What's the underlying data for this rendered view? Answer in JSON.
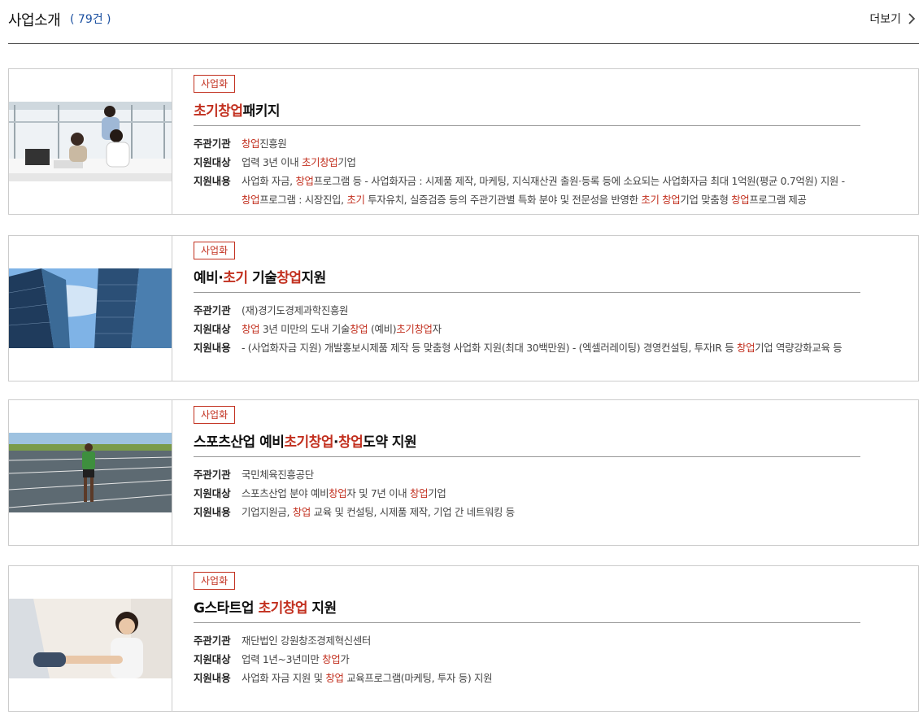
{
  "header": {
    "title": "사업소개",
    "count": "( 79건 )",
    "more_label": "더보기"
  },
  "labels": {
    "org": "주관기관",
    "target": "지원대상",
    "content": "지원내용"
  },
  "colors": {
    "highlight": "#c2301f",
    "count": "#1a4fa0"
  },
  "cards": [
    {
      "badge": "사업화",
      "image": "office-team-celebrating-photo",
      "title": [
        {
          "t": "초기창업",
          "h": true
        },
        {
          "t": "패키지",
          "h": false
        }
      ],
      "org": [
        {
          "t": "창업",
          "h": true
        },
        {
          "t": "진흥원",
          "h": false
        }
      ],
      "target": [
        {
          "t": "업력 3년 이내 ",
          "h": false
        },
        {
          "t": "초기창업",
          "h": true
        },
        {
          "t": "기업",
          "h": false
        }
      ],
      "content": [
        [
          {
            "t": "사업화 자금, ",
            "h": false
          },
          {
            "t": "창업",
            "h": true
          },
          {
            "t": "프로그램 등 - 사업화자금 : 시제품 제작, 마케팅, 지식재산권 출원·등록 등에 소요되는 사업화자금 최대 1억원(평균 0.7억원) 지원 -",
            "h": false
          }
        ],
        [
          {
            "t": "창업",
            "h": true
          },
          {
            "t": "프로그램 : 시장진입, ",
            "h": false
          },
          {
            "t": "초기",
            "h": true
          },
          {
            "t": " 투자유치, 실증검증 등의 주관기관별 특화 분야 및 전문성을 반영한 ",
            "h": false
          },
          {
            "t": "초기 창업",
            "h": true
          },
          {
            "t": "기업 맞춤형 ",
            "h": false
          },
          {
            "t": "창업",
            "h": true
          },
          {
            "t": "프로그램 제공",
            "h": false
          }
        ]
      ]
    },
    {
      "badge": "사업화",
      "image": "glass-skyscrapers-photo",
      "title": [
        {
          "t": "예비·",
          "h": false
        },
        {
          "t": "초기",
          "h": true
        },
        {
          "t": " 기술",
          "h": false
        },
        {
          "t": "창업",
          "h": true
        },
        {
          "t": "지원",
          "h": false
        }
      ],
      "org": [
        {
          "t": "(재)경기도경제과학진흥원",
          "h": false
        }
      ],
      "target": [
        {
          "t": "창업",
          "h": true
        },
        {
          "t": " 3년 미만의 도내 기술",
          "h": false
        },
        {
          "t": "창업",
          "h": true
        },
        {
          "t": " (예비)",
          "h": false
        },
        {
          "t": "초기창업",
          "h": true
        },
        {
          "t": "자",
          "h": false
        }
      ],
      "content": [
        [
          {
            "t": "- (사업화자금 지원) 개발홍보시제품 제작 등 맞춤형 사업화 지원(최대 30백만원) - (엑셀러레이팅) 경영컨설팅, 투자IR 등 ",
            "h": false
          },
          {
            "t": "창업",
            "h": true
          },
          {
            "t": "기업 역량강화교육 등",
            "h": false
          }
        ]
      ]
    },
    {
      "badge": "사업화",
      "image": "athlete-on-running-track-photo",
      "title": [
        {
          "t": "스포츠산업 예비",
          "h": false
        },
        {
          "t": "초기창업",
          "h": true
        },
        {
          "t": "·",
          "h": false
        },
        {
          "t": "창업",
          "h": true
        },
        {
          "t": "도약 지원",
          "h": false
        }
      ],
      "org": [
        {
          "t": "국민체육진흥공단",
          "h": false
        }
      ],
      "target": [
        {
          "t": "스포츠산업 분야 예비",
          "h": false
        },
        {
          "t": "창업",
          "h": true
        },
        {
          "t": "자 및 7년 이내 ",
          "h": false
        },
        {
          "t": "창업",
          "h": true
        },
        {
          "t": "기업",
          "h": false
        }
      ],
      "content": [
        [
          {
            "t": "기업지원금, ",
            "h": false
          },
          {
            "t": "창업",
            "h": true
          },
          {
            "t": " 교육 및 컨설팅, 시제품 제작, 기업 간 네트워킹 등",
            "h": false
          }
        ]
      ]
    },
    {
      "badge": "사업화",
      "image": "smiling-businesswoman-handshake-photo",
      "title": [
        {
          "t": "G스타트업 ",
          "h": false
        },
        {
          "t": "초기창업",
          "h": true
        },
        {
          "t": " 지원",
          "h": false
        }
      ],
      "org": [
        {
          "t": "재단법인 강원창조경제혁신센터",
          "h": false
        }
      ],
      "target": [
        {
          "t": "업력 1년~3년미만 ",
          "h": false
        },
        {
          "t": "창업",
          "h": true
        },
        {
          "t": "가",
          "h": false
        }
      ],
      "content": [
        [
          {
            "t": "사업화 자금 지원 및 ",
            "h": false
          },
          {
            "t": "창업",
            "h": true
          },
          {
            "t": " 교육프로그램(마케팅, 투자 등) 지원",
            "h": false
          }
        ]
      ]
    }
  ]
}
